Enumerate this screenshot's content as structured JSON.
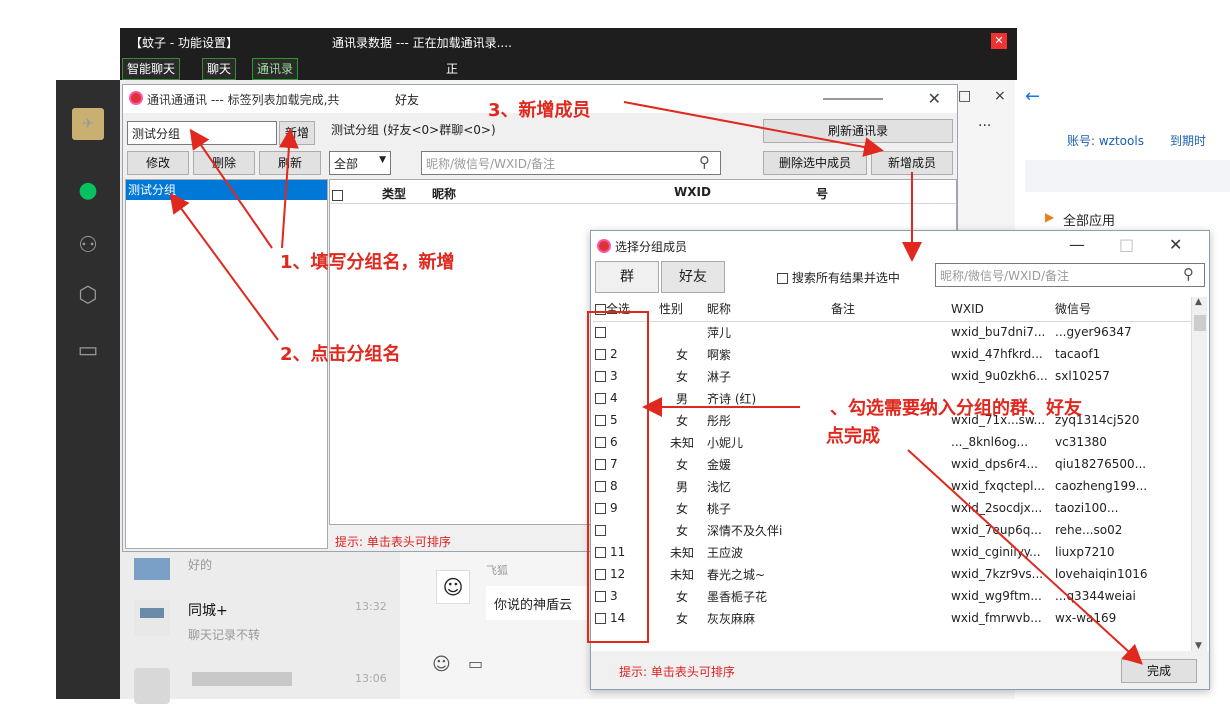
{
  "colors": {
    "accent_red": "#e0281e",
    "selection_blue": "#0078d7",
    "dark_bg": "#1e1e1e",
    "wechat_green": "#07c160"
  },
  "background": {
    "account_label": "账号: wztools",
    "expire_label": "到期时",
    "all_apps": "全部应用",
    "chats": [
      {
        "name": "",
        "preview": "好的",
        "time": ""
      },
      {
        "name": "同城+",
        "preview": "聊天记录不转",
        "time": "13:32"
      },
      {
        "name": "",
        "preview": "",
        "time": "13:06"
      }
    ],
    "chat_sender": "飞狐",
    "chat_message": "你说的神盾云",
    "sidebar_icons": [
      "chat-icon",
      "contacts-icon",
      "cube-icon",
      "folder-icon"
    ]
  },
  "dark_window": {
    "title": "【蚊子 - 功能设置】",
    "status": "通讯录数据 --- 正在加载通讯录....",
    "status2": "正",
    "tabs": [
      "智能聊天",
      "聊天",
      "通讯录"
    ]
  },
  "address_dialog": {
    "title": "通讯通通讯 --- 标签列表加载完成,共",
    "title_suffix": "好友",
    "group_name_value": "测试分组",
    "add_btn": "新增",
    "edit_btn": "修改",
    "delete_btn": "删除",
    "refresh_btn": "刷新",
    "groups": [
      "测试分组"
    ],
    "group_info": "测试分组 (好友<0>群聊<0>)",
    "refresh_contacts_btn": "刷新通讯录",
    "filter_value": "全部",
    "search_placeholder": "昵称/微信号/WXID/备注",
    "delete_selected_btn": "删除选中成员",
    "add_member_btn": "新增成员",
    "columns": [
      "类型",
      "昵称",
      "WXID",
      "号"
    ],
    "hint": "提示: 单击表头可排序"
  },
  "member_dialog": {
    "title": "选择分组成员",
    "tabs": [
      "群",
      "好友"
    ],
    "search_all_label": "搜索所有结果并选中",
    "search_placeholder": "昵称/微信号/WXID/备注",
    "columns": [
      "全选",
      "性别",
      "昵称",
      "备注",
      "WXID",
      "微信号"
    ],
    "rows": [
      {
        "no": "",
        "gender": "",
        "nick": "萍儿",
        "wxid": "wxid_bu7dni7...",
        "wechat": "...gyer96347"
      },
      {
        "no": "2",
        "gender": "女",
        "nick": "啊紫",
        "wxid": "wxid_47hfkrd...",
        "wechat": "tacaof1"
      },
      {
        "no": "3",
        "gender": "女",
        "nick": "淋子",
        "wxid": "wxid_9u0zkh6...",
        "wechat": "sxl10257"
      },
      {
        "no": "4",
        "gender": "男",
        "nick": "齐诗 (红)",
        "wxid": "",
        "wechat": ""
      },
      {
        "no": "5",
        "gender": "女",
        "nick": "彤彤",
        "wxid": "wxid_71x...sw...",
        "wechat": "zyq1314cj520"
      },
      {
        "no": "6",
        "gender": "未知",
        "nick": "小妮儿",
        "wxid": "..._8knl6og...",
        "wechat": "vc31380"
      },
      {
        "no": "7",
        "gender": "女",
        "nick": "金媛",
        "wxid": "wxid_dps6r4...",
        "wechat": "qiu18276500..."
      },
      {
        "no": "8",
        "gender": "男",
        "nick": "浅忆",
        "wxid": "wxid_fxqctepl...",
        "wechat": "caozheng199..."
      },
      {
        "no": "9",
        "gender": "女",
        "nick": "桃子",
        "wxid": "wxid_2socdjx...",
        "wechat": "taozi100..."
      },
      {
        "no": "",
        "gender": "女",
        "nick": "深情不及久伴i",
        "wxid": "wxid_7eup6q...",
        "wechat": "rehe...so02"
      },
      {
        "no": "11",
        "gender": "未知",
        "nick": "王应波",
        "wxid": "wxid_cginiiyy...",
        "wechat": "liuxp7210"
      },
      {
        "no": "12",
        "gender": "未知",
        "nick": "春光之城~",
        "wxid": "wxid_7kzr9vs...",
        "wechat": "lovehaiqin1016"
      },
      {
        "no": "3",
        "gender": "女",
        "nick": "墨香栀子花",
        "wxid": "wxid_wg9ftm...",
        "wechat": "...q3344weiai"
      },
      {
        "no": "14",
        "gender": "女",
        "nick": "灰灰麻麻",
        "wxid": "wxid_fmrwvb...",
        "wechat": "wx-wa169"
      }
    ],
    "hint": "提示: 单击表头可排序",
    "done_btn": "完成"
  },
  "annotations": {
    "step1": "1、填写分组名，新增",
    "step2": "2、点击分组名",
    "step3": "3、新增成员",
    "step4a": "、勾选需要纳入分组的群、好友",
    "step4b": "点完成"
  }
}
